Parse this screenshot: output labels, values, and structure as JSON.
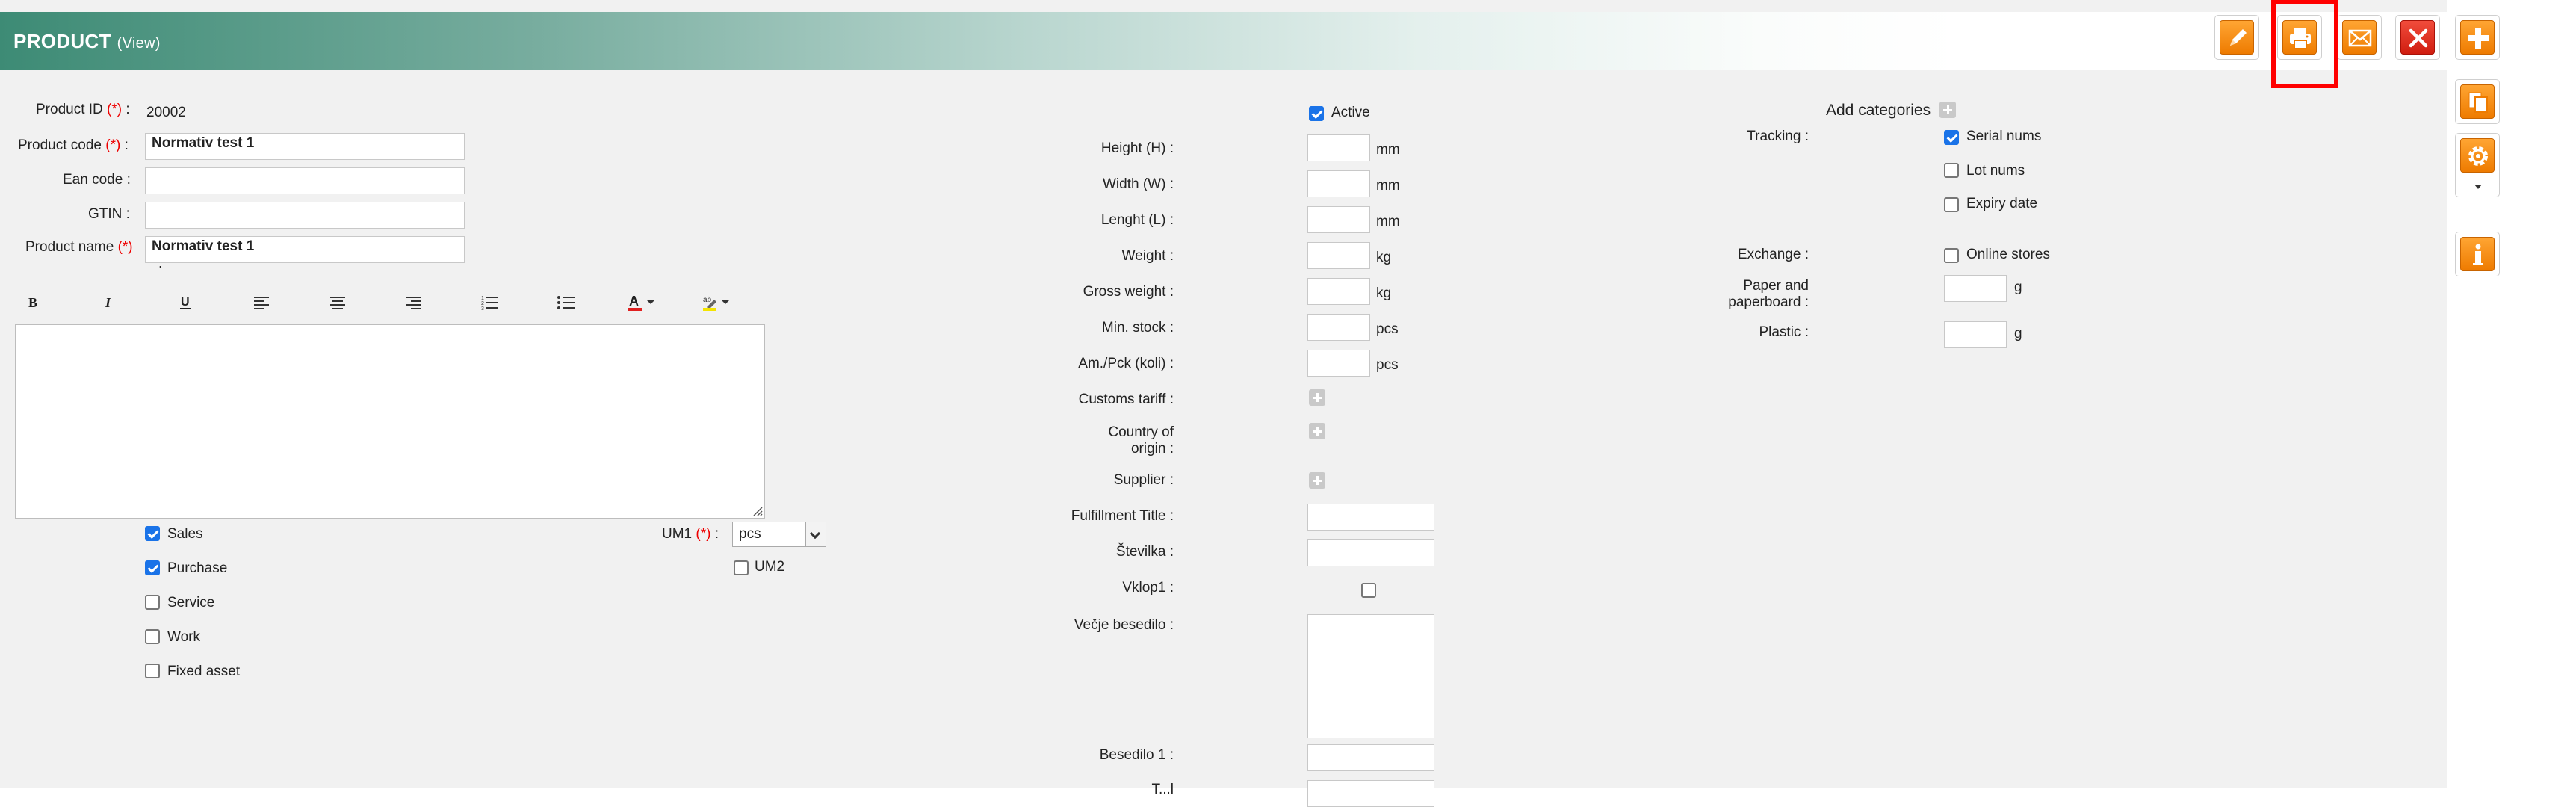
{
  "header": {
    "title": "PRODUCT",
    "mode": "(View)"
  },
  "toolbar": {
    "icons": [
      "edit-icon",
      "print-icon",
      "email-icon",
      "delete-icon",
      "add-icon",
      "copy-icon",
      "settings-icon",
      "info-icon"
    ],
    "accent": "#ee7b00",
    "danger": "#d01d10",
    "highlighted_button": "print"
  },
  "required_mark": "(*)",
  "left": {
    "product_id_label": "Product ID",
    "product_id_value": "20002",
    "product_code_label": "Product code",
    "product_code_value": "Normativ test 1",
    "ean_label": "Ean code",
    "ean_value": "",
    "gtin_label": "GTIN",
    "gtin_value": "",
    "product_name_label": "Product name",
    "product_name_value": "Normativ test 1",
    "editor_buttons": [
      "bold-icon",
      "italic-icon",
      "underline-icon",
      "align-left-icon",
      "align-center-icon",
      "align-right-icon",
      "numbered-list-icon",
      "bullet-list-icon",
      "text-color-icon",
      "highlight-color-icon"
    ],
    "checkboxes": [
      {
        "label": "Sales",
        "checked": true
      },
      {
        "label": "Purchase",
        "checked": true
      },
      {
        "label": "Service",
        "checked": false
      },
      {
        "label": "Work",
        "checked": false
      },
      {
        "label": "Fixed asset",
        "checked": false
      }
    ],
    "um1_label": "UM1",
    "um1_value": "pcs",
    "um2_label": "UM2",
    "um2_checked": false
  },
  "middle": {
    "active_label": "Active",
    "active_checked": true,
    "height_label": "Height (H) :",
    "height_unit": "mm",
    "width_label": "Width (W) :",
    "width_unit": "mm",
    "length_label": "Lenght (L) :",
    "length_unit": "mm",
    "weight_label": "Weight :",
    "weight_unit": "kg",
    "gross_weight_label": "Gross weight :",
    "gross_weight_unit": "kg",
    "min_stock_label": "Min. stock :",
    "min_stock_unit": "pcs",
    "am_pck_label": "Am./Pck (koli) :",
    "am_pck_unit": "pcs",
    "customs_label": "Customs tariff :",
    "country_label_1": "Country of",
    "country_label_2": "origin :",
    "supplier_label": "Supplier :",
    "fulfillment_label": "Fulfillment Title :",
    "stevilka_label": "Številka :",
    "vklop_label": "Vklop1 :",
    "vklop_checked": false,
    "vecje_label": "Večje besedilo :",
    "besedilo_label": "Besedilo 1 :",
    "cut_label": "T...l"
  },
  "right": {
    "add_categories_label": "Add categories",
    "tracking_label": "Tracking :",
    "tracking": [
      {
        "label": "Serial nums",
        "checked": true
      },
      {
        "label": "Lot nums",
        "checked": false
      },
      {
        "label": "Expiry date",
        "checked": false
      }
    ],
    "exchange_label": "Exchange :",
    "online_stores_label": "Online stores",
    "online_stores_checked": false,
    "paper_label_1": "Paper and",
    "paper_label_2": "paperboard :",
    "paper_unit": "g",
    "plastic_label": "Plastic :",
    "plastic_unit": "g"
  }
}
